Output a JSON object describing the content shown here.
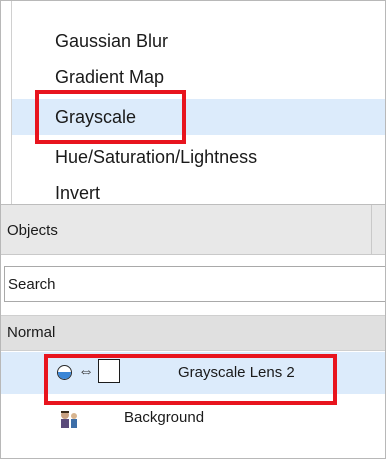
{
  "filters": {
    "items": [
      {
        "label": "Gaussian Blur",
        "selected": false
      },
      {
        "label": "Gradient Map",
        "selected": false
      },
      {
        "label": "Grayscale",
        "selected": true
      },
      {
        "label": "Hue/Saturation/Lightness",
        "selected": false
      },
      {
        "label": "Invert",
        "selected": false
      }
    ]
  },
  "objects_panel": {
    "title": "Objects",
    "search": {
      "value": "Search"
    },
    "blend_mode": "Normal",
    "layers": [
      {
        "name": "Grayscale Lens 2",
        "selected": true,
        "icons": [
          "visibility-icon",
          "link-icon",
          "mask-thumbnail"
        ]
      },
      {
        "name": "Background",
        "selected": false,
        "icons": [
          "image-thumbnail"
        ]
      }
    ]
  },
  "colors": {
    "highlight": "#e8141e",
    "selection": "#dcebfb",
    "header_bg": "#e8e8e8"
  }
}
